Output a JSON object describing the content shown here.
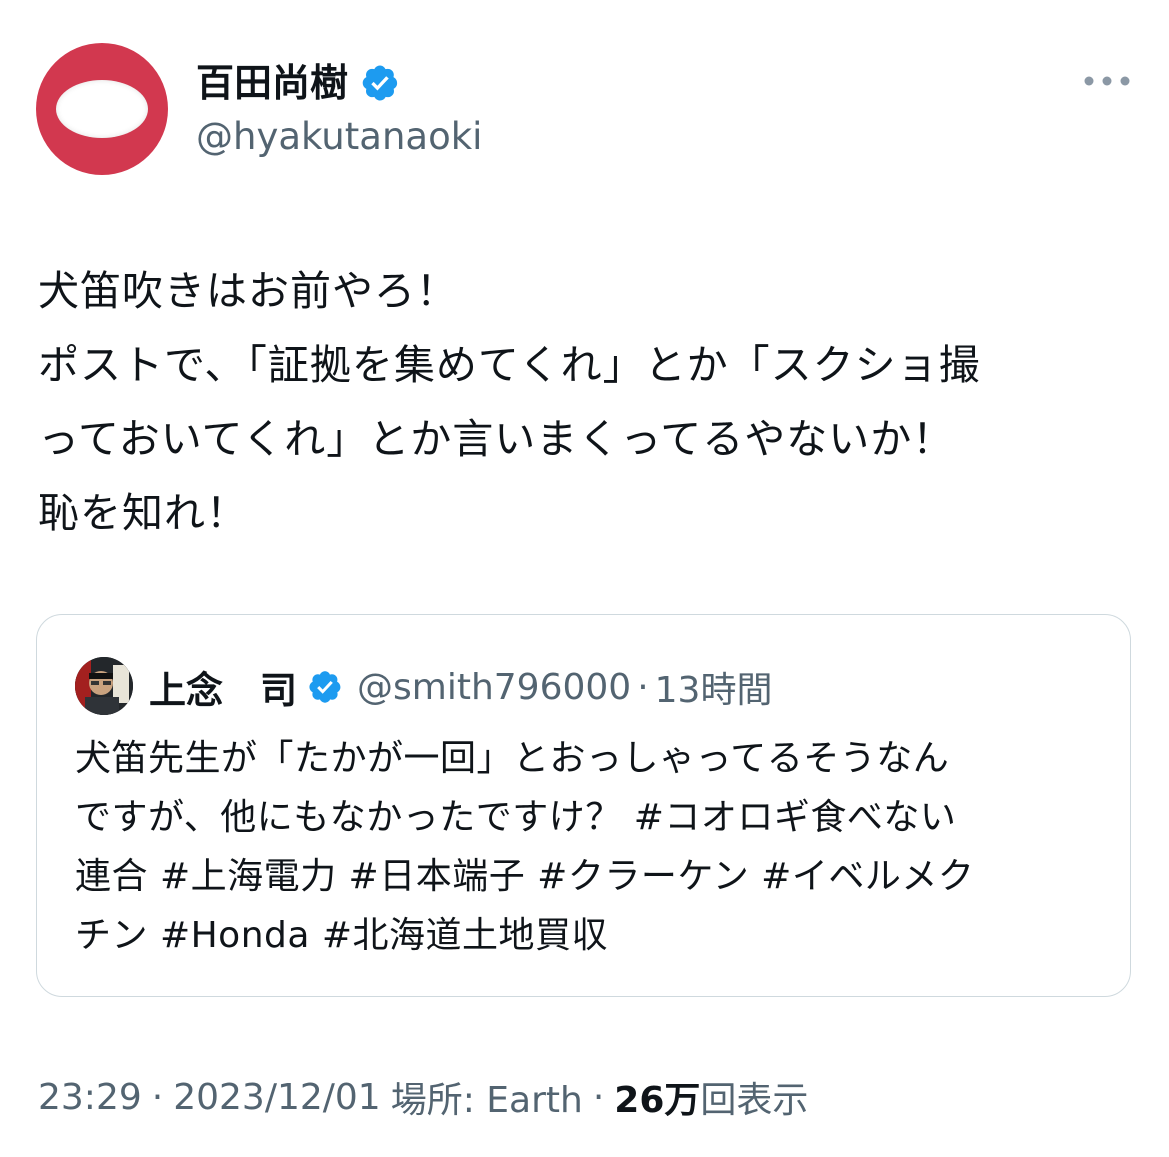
{
  "author": {
    "display_name": "百田尚樹",
    "handle": "@hyakutanaoki",
    "verified_icon": "verified-badge-icon"
  },
  "post": {
    "lines": [
      "犬笛吹きはお前やろ！",
      "ポストで、「証拠を集めてくれ」とか「スクショ撮",
      "っておいてくれ」とか言いまくってるやないか！",
      "恥を知れ！"
    ]
  },
  "quoted_post": {
    "display_name": "上念　司",
    "handle": "@smith796000",
    "separator": "·",
    "time": "13時間",
    "lines": [
      "犬笛先生が「たかが一回」とおっしゃってるそうなん",
      "ですが、他にもなかったですけ？ #コオロギ食べない",
      "連合 #上海電力 #日本端子 #クラーケン #イベルメク",
      "チン #Honda #北海道土地買収"
    ]
  },
  "meta": {
    "time": "23:29",
    "sep1": "·",
    "date": "2023/12/01",
    "location": "場所: Earth",
    "sep2": "·",
    "views_count": "26万",
    "views_label": "回表示"
  },
  "colors": {
    "avatar_bg": "#d2384f",
    "verified_blue": "#1d9bf0",
    "secondary_text": "#536471"
  }
}
